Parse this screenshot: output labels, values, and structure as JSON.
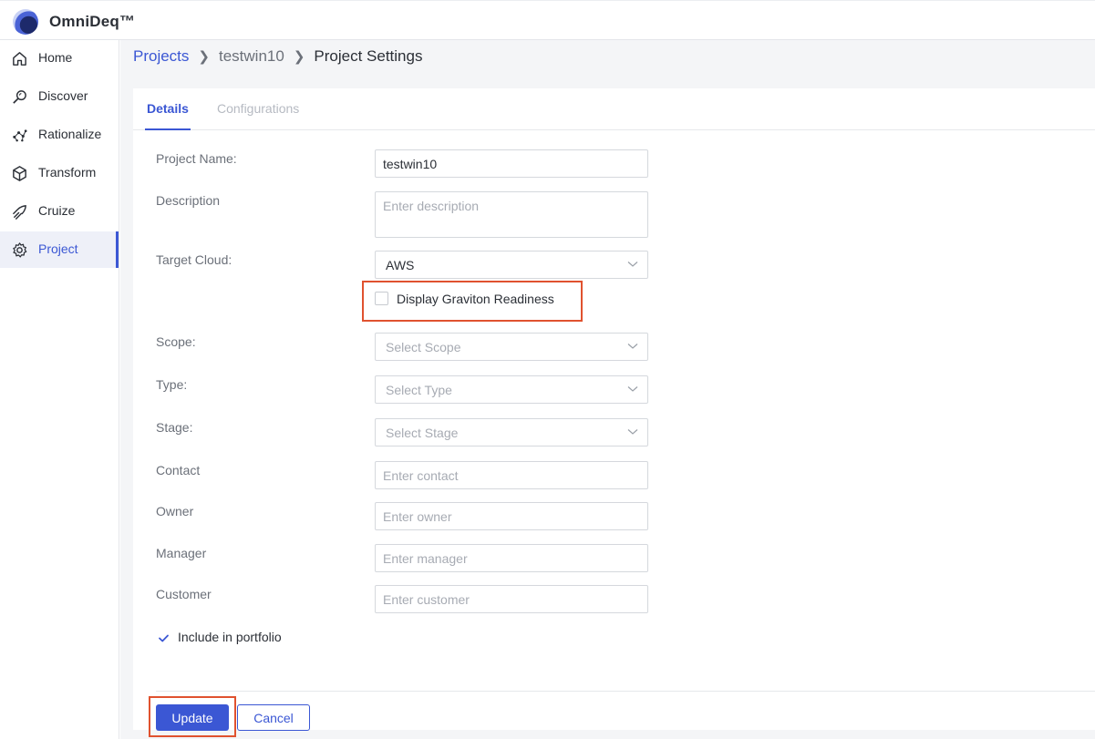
{
  "app": {
    "name": "OmniDeq™"
  },
  "sidebar": {
    "items": [
      {
        "label": "Home",
        "icon": "home-icon"
      },
      {
        "label": "Discover",
        "icon": "discover-icon"
      },
      {
        "label": "Rationalize",
        "icon": "rationalize-icon"
      },
      {
        "label": "Transform",
        "icon": "cube-icon"
      },
      {
        "label": "Cruize",
        "icon": "cruize-icon"
      },
      {
        "label": "Project",
        "icon": "gear-icon",
        "active": true
      }
    ]
  },
  "breadcrumb": {
    "projects": "Projects",
    "project": "testwin10",
    "current": "Project Settings"
  },
  "tabs": {
    "details": "Details",
    "configurations": "Configurations",
    "active": "Details"
  },
  "form": {
    "project_name": {
      "label": "Project Name:",
      "value": "testwin10"
    },
    "description": {
      "label": "Description",
      "placeholder": "Enter description"
    },
    "target_cloud": {
      "label": "Target Cloud:",
      "value": "AWS"
    },
    "graviton": {
      "label": "Display Graviton Readiness",
      "checked": false
    },
    "scope": {
      "label": "Scope:",
      "placeholder": "Select Scope"
    },
    "type": {
      "label": "Type:",
      "placeholder": "Select Type"
    },
    "stage": {
      "label": "Stage:",
      "placeholder": "Select Stage"
    },
    "contact": {
      "label": "Contact",
      "placeholder": "Enter contact"
    },
    "owner": {
      "label": "Owner",
      "placeholder": "Enter owner"
    },
    "manager": {
      "label": "Manager",
      "placeholder": "Enter manager"
    },
    "customer": {
      "label": "Customer",
      "placeholder": "Enter customer"
    },
    "portfolio": {
      "label": "Include in portfolio",
      "checked": true
    }
  },
  "actions": {
    "update": "Update",
    "cancel": "Cancel"
  },
  "colors": {
    "accent": "#3b57d4",
    "highlight": "#e0522f"
  }
}
